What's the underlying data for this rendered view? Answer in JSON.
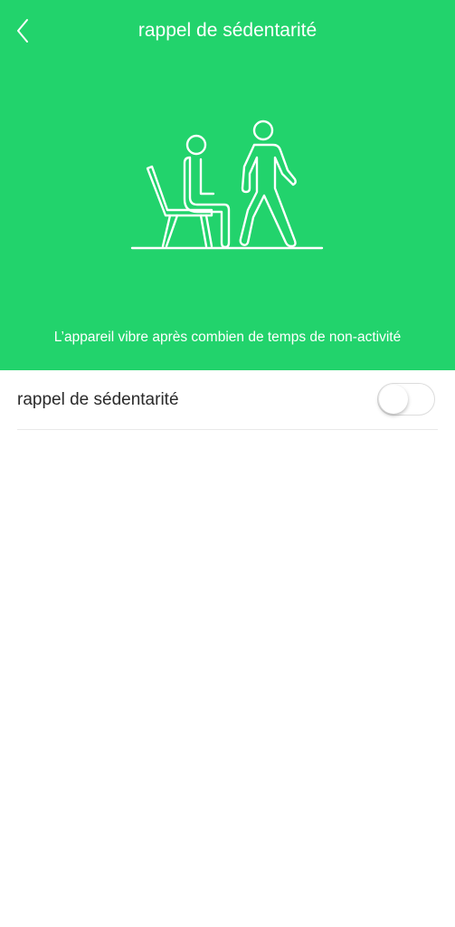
{
  "header": {
    "title": "rappel de sédentarité",
    "back_icon": "chevron-left-icon",
    "subtitle": "L’appareil vibre après combien de temps de non-activité",
    "illustration": "sitting-and-walking-person-icon",
    "background_color": "#22d36c"
  },
  "settings": {
    "row_label": "rappel de sédentarité",
    "toggle_on": false
  }
}
